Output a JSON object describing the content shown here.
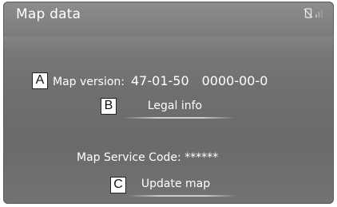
{
  "screen": {
    "title": "Map data",
    "status_icons": [
      "phone-disconnected-icon",
      "signal-icon"
    ]
  },
  "map_version": {
    "label": "Map version:",
    "version": "47-01-50",
    "date": "0000-00-0"
  },
  "buttons": {
    "legal_info": "Legal info",
    "update_map": "Update map"
  },
  "service_code": {
    "text": "Map Service Code: ******"
  },
  "callouts": {
    "a": "A",
    "b": "B",
    "c": "C"
  }
}
